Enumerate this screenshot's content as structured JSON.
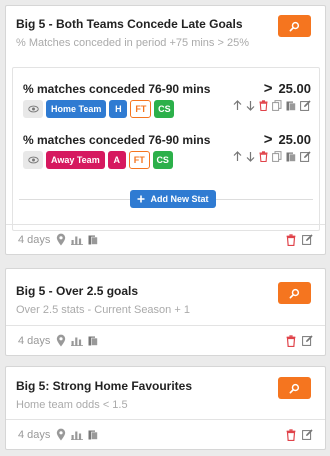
{
  "cards": [
    {
      "title": "Big 5 - Both Teams Concede Late Goals",
      "subtitle": "% Matches conceded in period +75 mins > 25%",
      "age": "4 days",
      "stats": [
        {
          "name": "% matches conceded 76-90 mins",
          "operator": ">",
          "value": "25.00",
          "team": "Home Team",
          "side": "H",
          "period": "FT",
          "scope": "CS"
        },
        {
          "name": "% matches conceded 76-90 mins",
          "operator": ">",
          "value": "25.00",
          "team": "Away Team",
          "side": "A",
          "period": "FT",
          "scope": "CS"
        }
      ],
      "add_stat_label": "Add New Stat"
    },
    {
      "title": "Big 5 - Over 2.5 goals",
      "subtitle": "Over 2.5 stats - Current Season + 1",
      "age": "4 days"
    },
    {
      "title": "Big 5: Strong Home Favourites",
      "subtitle": "Home team odds < 1.5",
      "age": "4 days"
    }
  ],
  "colors": {
    "accent": "#f5751f",
    "primary": "#2f7bd2",
    "home": "#2f7bd2",
    "away": "#d6195f",
    "cs": "#2cb04a",
    "delete": "#e0434a"
  },
  "icons": [
    "search-icon",
    "eye-icon",
    "arrow-up-icon",
    "arrow-down-icon",
    "trash-icon",
    "copy-icon",
    "paste-icon",
    "edit-icon",
    "pin-icon",
    "chart-icon",
    "plus-icon"
  ]
}
